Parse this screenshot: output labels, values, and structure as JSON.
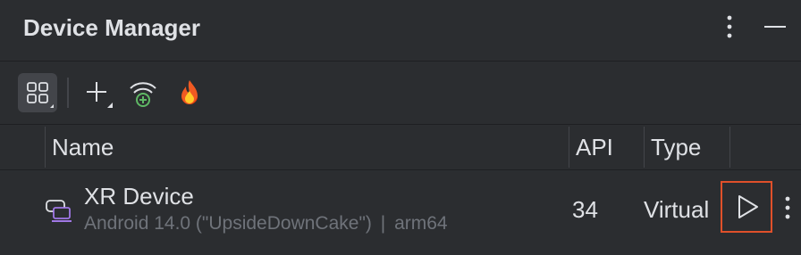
{
  "panel": {
    "title": "Device Manager"
  },
  "title_actions": [
    {
      "icon": "kebab-menu-icon"
    },
    {
      "icon": "minimize-icon"
    }
  ],
  "toolbar": {
    "buttons": [
      {
        "icon": "device-grid-icon",
        "selected": true
      },
      {
        "icon": "add-device-icon"
      },
      {
        "icon": "wifi-pair-icon"
      },
      {
        "icon": "firebase-icon"
      }
    ]
  },
  "table": {
    "columns": [
      "Name",
      "API",
      "Type"
    ],
    "rows": [
      {
        "icon": "xr-headset-icon",
        "name": "XR Device",
        "subtitle_os": "Android 14.0 (\"UpsideDownCake\")",
        "subtitle_sep": "|",
        "subtitle_arch": "arm64",
        "api": "34",
        "type": "Virtual",
        "actions": [
          "play-icon",
          "kebab-menu-icon"
        ]
      }
    ]
  },
  "colors": {
    "background": "#2b2d30",
    "text": "#dfe1e5",
    "muted_text": "#6f737a",
    "highlight_border": "#e0502a",
    "device_icon": "#a178e6"
  }
}
